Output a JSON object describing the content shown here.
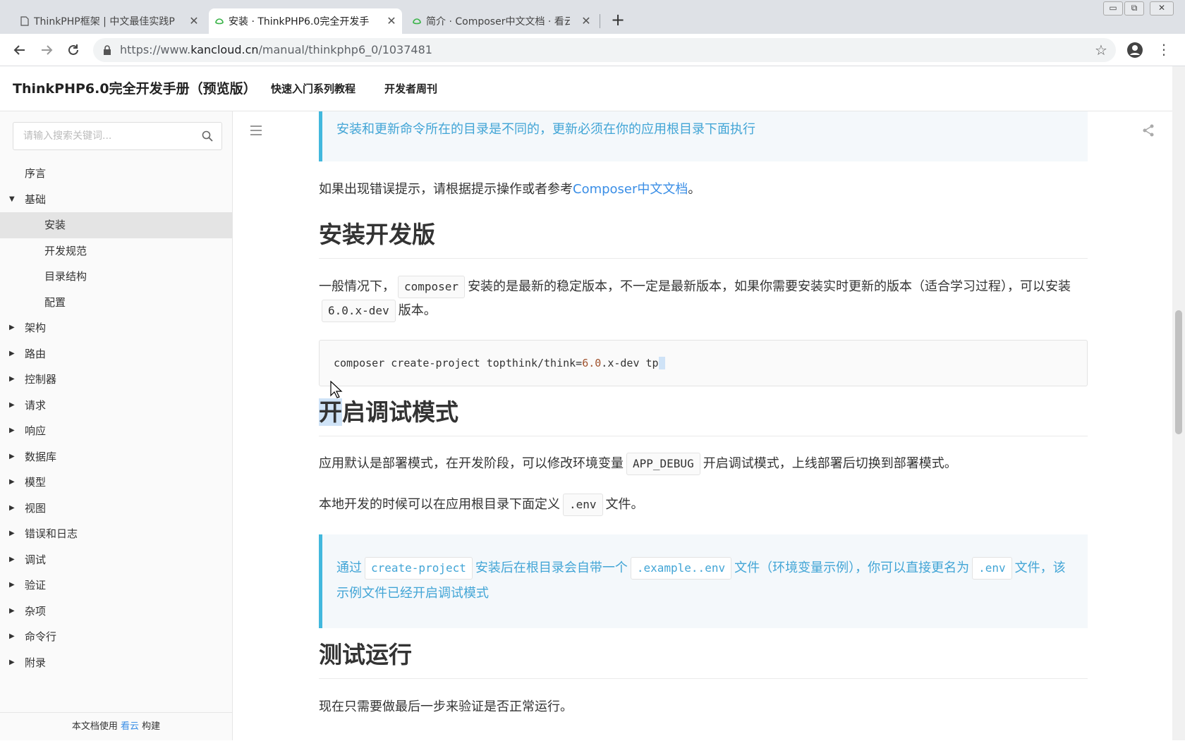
{
  "browser": {
    "tabs": [
      {
        "title": "ThinkPHP框架 | 中文最佳实践P",
        "active": false,
        "favicon": "page-icon"
      },
      {
        "title": "安装 · ThinkPHP6.0完全开发手",
        "active": true,
        "favicon": "kancloud-icon"
      },
      {
        "title": "简介 · Composer中文文档 · 看云",
        "active": false,
        "favicon": "kancloud-icon"
      }
    ],
    "close_glyph": "✕",
    "new_tab_glyph": "+",
    "url_prefix": "https://www.",
    "url_domain": "kancloud.cn",
    "url_path": "/manual/thinkphp6_0/1037481",
    "window_controls": [
      "▭",
      "⧉",
      "✕"
    ]
  },
  "header": {
    "brand": "ThinkPHP6.0完全开发手册（预览版）",
    "links": [
      "快速入门系列教程",
      "开发者周刊"
    ]
  },
  "sidebar": {
    "search_placeholder": "请输入搜索关键词...",
    "items": [
      {
        "label": "序言",
        "level": 1,
        "arrow": ""
      },
      {
        "label": "基础",
        "level": 1,
        "arrow": "▼"
      },
      {
        "label": "安装",
        "level": 2,
        "arrow": "",
        "active": true
      },
      {
        "label": "开发规范",
        "level": 2,
        "arrow": ""
      },
      {
        "label": "目录结构",
        "level": 2,
        "arrow": ""
      },
      {
        "label": "配置",
        "level": 2,
        "arrow": ""
      },
      {
        "label": "架构",
        "level": 1,
        "arrow": "▶"
      },
      {
        "label": "路由",
        "level": 1,
        "arrow": "▶"
      },
      {
        "label": "控制器",
        "level": 1,
        "arrow": "▶"
      },
      {
        "label": "请求",
        "level": 1,
        "arrow": "▶"
      },
      {
        "label": "响应",
        "level": 1,
        "arrow": "▶"
      },
      {
        "label": "数据库",
        "level": 1,
        "arrow": "▶"
      },
      {
        "label": "模型",
        "level": 1,
        "arrow": "▶"
      },
      {
        "label": "视图",
        "level": 1,
        "arrow": "▶"
      },
      {
        "label": "错误和日志",
        "level": 1,
        "arrow": "▶"
      },
      {
        "label": "调试",
        "level": 1,
        "arrow": "▶"
      },
      {
        "label": "验证",
        "level": 1,
        "arrow": "▶"
      },
      {
        "label": "杂项",
        "level": 1,
        "arrow": "▶"
      },
      {
        "label": "命令行",
        "level": 1,
        "arrow": "▶"
      },
      {
        "label": "附录",
        "level": 1,
        "arrow": "▶"
      }
    ],
    "footer_prefix": "本文档使用",
    "footer_link": "看云",
    "footer_suffix": "构建"
  },
  "article": {
    "callout1": "安装和更新命令所在的目录是不同的，更新必须在你的应用根目录下面执行",
    "p1_text": "如果出现错误提示，请根据提示操作或者参考",
    "p1_link": "Composer中文文档",
    "p1_end": "。",
    "h2_install_dev": "安装开发版",
    "p2_a": "一般情况下，",
    "p2_code1": "composer",
    "p2_b": "安装的是最新的稳定版本，不一定是最新版本，如果你需要安装实时更新的版本（适合学习过程），可以安装",
    "p2_code2": "6.0.x-dev",
    "p2_c": "版本。",
    "code_block_a": "composer create-project topthink/think=",
    "code_block_num": "6.0",
    "code_block_b": ".x-dev tp",
    "h2_debug_sel": "开",
    "h2_debug_rest": "启调试模式",
    "p3_a": "应用默认是部署模式，在开发阶段，可以修改环境变量",
    "p3_code": "APP_DEBUG",
    "p3_b": "开启调试模式，上线部署后切换到部署模式。",
    "p4_a": "本地开发的时候可以在应用根目录下面定义",
    "p4_code": ".env",
    "p4_b": "文件。",
    "callout2_a": "通过",
    "callout2_code1": "create-project",
    "callout2_b": "安装后在根目录会自带一个",
    "callout2_code2": ".example..env",
    "callout2_c": "文件（环境变量示例），你可以直接更名为",
    "callout2_code3": ".env",
    "callout2_d": "文件，该示例文件已经开启调试模式",
    "h2_test_run": "测试运行",
    "p5": "现在只需要做最后一步来验证是否正常运行。"
  },
  "colors": {
    "accent": "#3a8ee6",
    "callout_border": "#42b8dd",
    "callout_text": "#42a5d6",
    "active_item_bg": "#e4e4e4"
  }
}
